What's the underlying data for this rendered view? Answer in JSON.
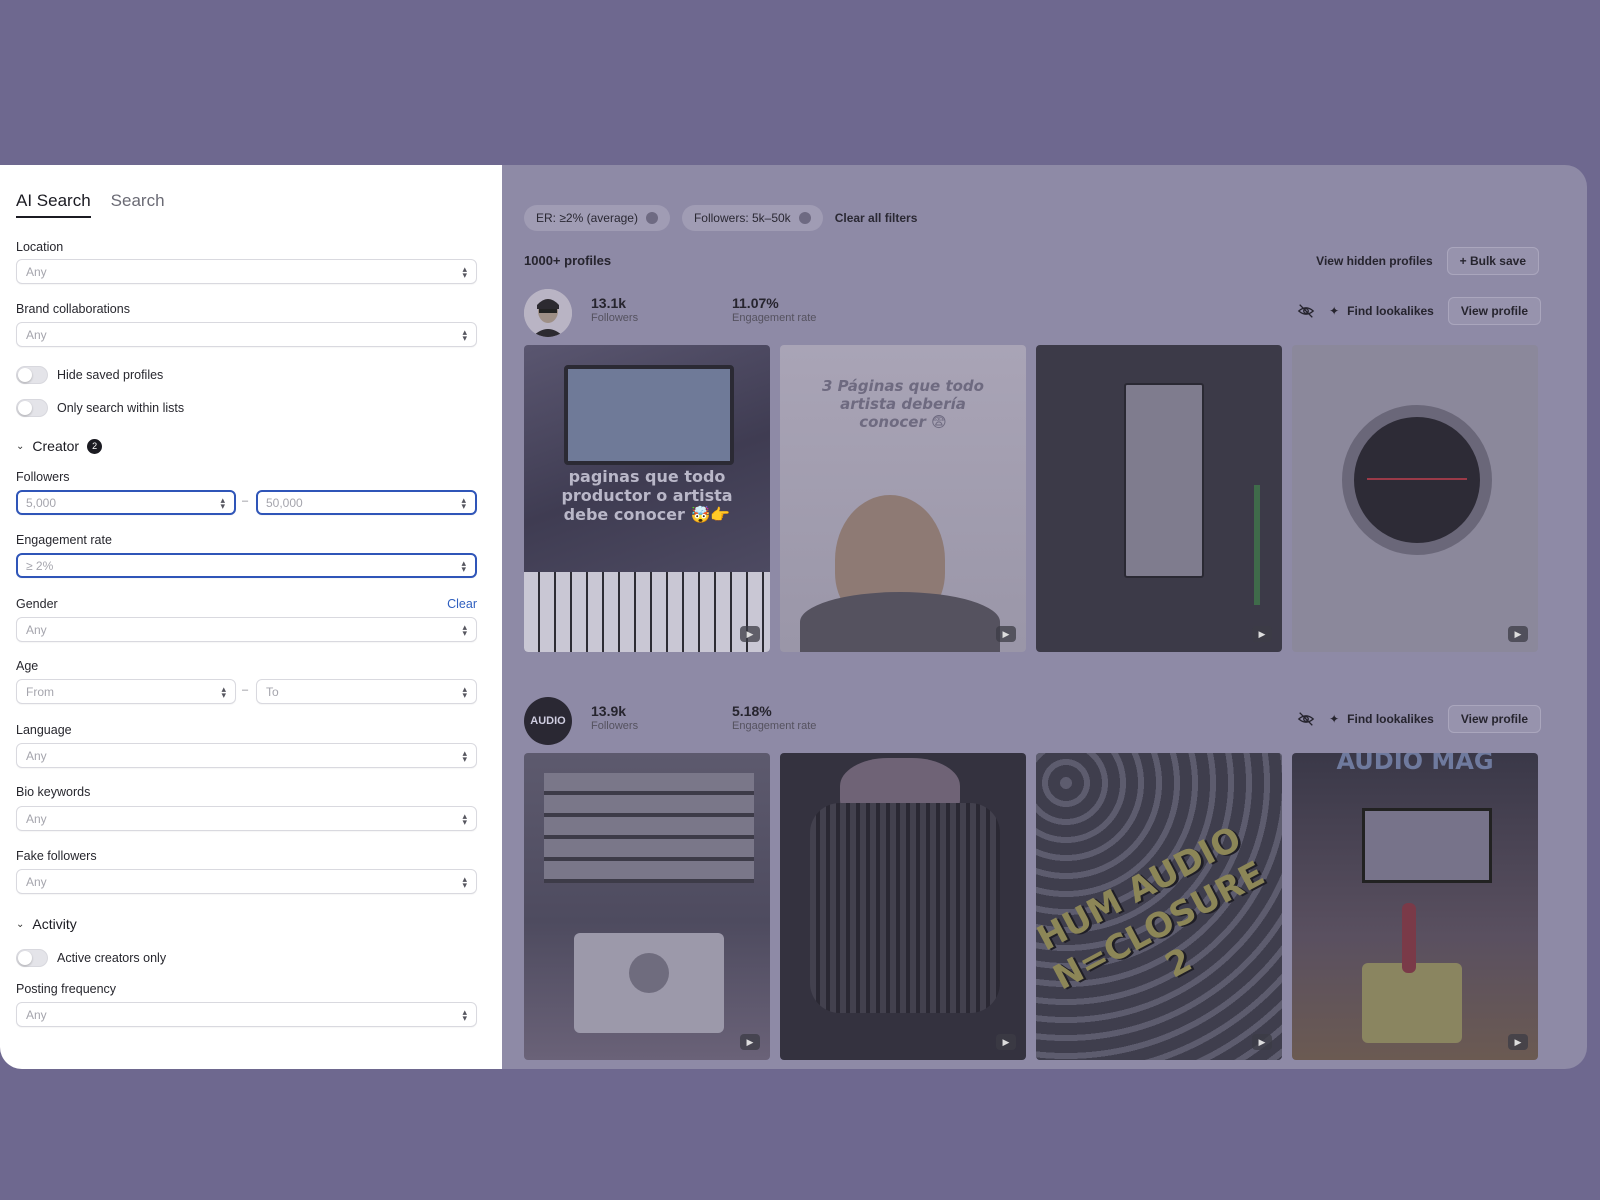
{
  "tabs": [
    {
      "label": "AI Search"
    },
    {
      "label": "Search"
    }
  ],
  "filters": {
    "location": {
      "label": "Location",
      "placeholder": "Any"
    },
    "brand": {
      "label": "Brand collaborations",
      "placeholder": "Any"
    },
    "hide_saved": "Hide saved profiles",
    "only_lists": "Only search within lists",
    "creator": {
      "title": "Creator",
      "count": "2"
    },
    "followers": {
      "label": "Followers",
      "min": "5,000",
      "max": "50,000",
      "dash": "–"
    },
    "engagement": {
      "label": "Engagement rate",
      "value": "≥ 2%"
    },
    "gender": {
      "label": "Gender",
      "clear": "Clear",
      "placeholder": "Any"
    },
    "age": {
      "label": "Age",
      "from": "From",
      "to": "To",
      "dash": "–"
    },
    "language": {
      "label": "Language",
      "placeholder": "Any"
    },
    "bio": {
      "label": "Bio keywords",
      "placeholder": "Any"
    },
    "fake": {
      "label": "Fake followers",
      "placeholder": "Any"
    },
    "activity": {
      "title": "Activity"
    },
    "active_only": "Active creators only",
    "posting": {
      "label": "Posting frequency",
      "placeholder": "Any"
    }
  },
  "chips": [
    {
      "label": "ER: ≥2% (average)"
    },
    {
      "label": "Followers: 5k–50k"
    }
  ],
  "clear_all": "Clear all filters",
  "results_count": "1000+ profiles",
  "view_hidden": "View hidden profiles",
  "bulk_save": "+ Bulk save",
  "profiles": [
    {
      "followers": "13.1k",
      "followers_label": "Followers",
      "er": "11.07%",
      "er_label": "Engagement rate",
      "find": "Find lookalikes",
      "view": "View profile",
      "thumbs": [
        {
          "caption": "paginas que todo productor o artista debe conocer 🤯👉"
        },
        {
          "caption": "3 Páginas que todo artista debería conocer 😨"
        },
        {
          "caption": ""
        },
        {
          "caption": ""
        }
      ]
    },
    {
      "avatar_text": "AUDIO",
      "followers": "13.9k",
      "followers_label": "Followers",
      "er": "5.18%",
      "er_label": "Engagement rate",
      "find": "Find lookalikes",
      "view": "View profile",
      "thumbs": [
        {
          "caption": ""
        },
        {
          "caption": ""
        },
        {
          "caption": "HUM AUDIO N=CLOSURE 2"
        },
        {
          "caption": "AUDIO MAG"
        }
      ]
    }
  ],
  "colors": {
    "accent": "#2f55b8",
    "background": "#6e688f",
    "overlay": "#8e8aa6"
  }
}
